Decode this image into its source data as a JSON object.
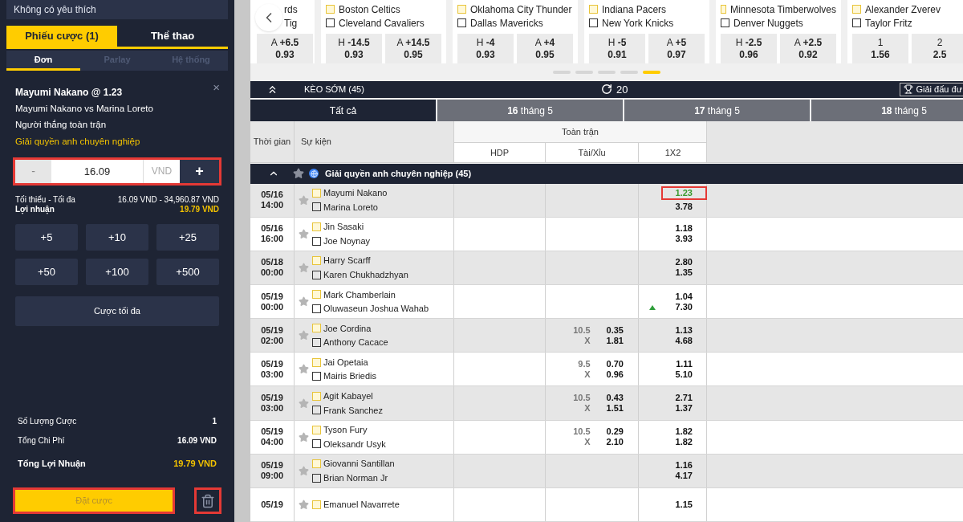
{
  "sidebar": {
    "favorites_label": "Không có yêu thích",
    "tabs": [
      {
        "label": "Phiếu cược (1)",
        "selected": true
      },
      {
        "label": "Thể thao",
        "selected": false
      }
    ],
    "sub_tabs": [
      {
        "label": "Đơn",
        "selected": true,
        "disabled": false
      },
      {
        "label": "Parlay",
        "selected": false,
        "disabled": true
      },
      {
        "label": "Hệ thống",
        "selected": false,
        "disabled": true
      }
    ],
    "bet": {
      "title": "Mayumi Nakano @ 1.23",
      "close": "×",
      "match": "Mayumi Nakano vs Marina Loreto",
      "market": "Người thắng toàn trận",
      "league": "Giải quyền anh chuyên nghiệp",
      "stake": {
        "minus": "-",
        "value": "16.09",
        "currency": "VND",
        "plus": "+",
        "highlighted": true
      },
      "limits_label": "Tối thiểu - Tối đa",
      "limits": "16.09 VND - 34,960.87 VND",
      "profit_label": "Lợi nhuận",
      "profit": "19.79 VND"
    },
    "quick_amounts": [
      "+5",
      "+10",
      "+25",
      "+50",
      "+100",
      "+500"
    ],
    "max_bet": "Cược tối đa",
    "summary": [
      {
        "label": "Số Lượng Cược",
        "value": "1",
        "kind": "plain"
      },
      {
        "label": "Tổng Chi Phí",
        "value": "16.09 VND",
        "kind": "plain"
      },
      {
        "label": "Tổng Lợi Nhuận",
        "value": "19.79 VND",
        "kind": "total"
      }
    ],
    "place_bet": {
      "label": "Đặt cược",
      "disabled": true,
      "highlighted": true
    },
    "delete": {
      "highlighted": true
    }
  },
  "carousel": {
    "cards": [
      {
        "kind": "partial",
        "teams": [
          "rds",
          "Tig"
        ],
        "odds": [
          {
            "side": "A",
            "line": "+6.5",
            "value": "0.93"
          }
        ]
      },
      {
        "kind": "full",
        "teams": [
          "Boston Celtics",
          "Cleveland Cavaliers"
        ],
        "odds": [
          {
            "side": "H",
            "line": "-14.5",
            "value": "0.93"
          },
          {
            "side": "A",
            "line": "+14.5",
            "value": "0.95"
          }
        ]
      },
      {
        "kind": "full",
        "teams": [
          "Oklahoma City Thunder",
          "Dallas Mavericks"
        ],
        "odds": [
          {
            "side": "H",
            "line": "-4",
            "value": "0.93"
          },
          {
            "side": "A",
            "line": "+4",
            "value": "0.95"
          }
        ]
      },
      {
        "kind": "full",
        "teams": [
          "Indiana Pacers",
          "New York Knicks"
        ],
        "odds": [
          {
            "side": "H",
            "line": "-5",
            "value": "0.91"
          },
          {
            "side": "A",
            "line": "+5",
            "value": "0.97"
          }
        ]
      },
      {
        "kind": "full",
        "teams": [
          "Minnesota Timberwolves",
          "Denver Nuggets"
        ],
        "odds": [
          {
            "side": "H",
            "line": "-2.5",
            "value": "0.96"
          },
          {
            "side": "A",
            "line": "+2.5",
            "value": "0.92"
          }
        ]
      },
      {
        "kind": "full",
        "teams": [
          "Alexander Zverev",
          "Taylor Fritz"
        ],
        "odds": [
          {
            "side": "1",
            "value": "1.56"
          },
          {
            "side": "2",
            "value": "2.5"
          }
        ]
      }
    ],
    "pages": [
      {
        "selected": false
      },
      {
        "selected": false
      },
      {
        "selected": false
      },
      {
        "selected": false
      },
      {
        "selected": true
      }
    ]
  },
  "early_bar": {
    "title": "KÈO SỚM (45)",
    "refresh_count": "20",
    "tournaments_button": "Giải đấu đư"
  },
  "date_tabs": [
    {
      "label": "Tất cả",
      "selected": true
    },
    {
      "label": "**16** tháng 5",
      "selected": false
    },
    {
      "label": "**17** tháng 5",
      "selected": false
    },
    {
      "label": "**18** tháng 5",
      "selected": false
    }
  ],
  "table": {
    "columns": {
      "time": "Thời gian",
      "event": "Sự kiện",
      "group": "Toàn trận",
      "hdp": "HDP",
      "ou": "Tài/Xỉu",
      "x12": "1X2"
    },
    "league": "Giải quyền anh chuyên nghiệp (45)",
    "rows": [
      {
        "date": "05/16",
        "time": "14:00",
        "home": "Mayumi Nakano",
        "away": "Marina Loreto",
        "rising": false,
        "x12": [
          {
            "value": "1.23",
            "selected": true
          },
          {
            "value": "3.78",
            "selected": false
          }
        ]
      },
      {
        "date": "05/16",
        "time": "16:00",
        "home": "Jin Sasaki",
        "away": "Joe Noynay",
        "rising": false,
        "x12": [
          {
            "value": "1.18",
            "selected": false
          },
          {
            "value": "3.93",
            "selected": false
          }
        ]
      },
      {
        "date": "05/18",
        "time": "00:00",
        "home": "Harry Scarff",
        "away": "Karen Chukhadzhyan",
        "rising": false,
        "x12": [
          {
            "value": "2.80",
            "selected": false
          },
          {
            "value": "1.35",
            "selected": false
          }
        ]
      },
      {
        "date": "05/19",
        "time": "00:00",
        "home": "Mark Chamberlain",
        "away": "Oluwaseun Joshua Wahab",
        "rising": true,
        "x12": [
          {
            "value": "1.04",
            "selected": false
          },
          {
            "value": "7.30",
            "selected": false
          }
        ]
      },
      {
        "date": "05/19",
        "time": "02:00",
        "home": "Joe Cordina",
        "away": "Anthony Cacace",
        "rising": false,
        "ou": {
          "line": "10.5",
          "under_mark": "X",
          "over": "0.35",
          "under": "1.81"
        },
        "x12": [
          {
            "value": "1.13",
            "selected": false
          },
          {
            "value": "4.68",
            "selected": false
          }
        ]
      },
      {
        "date": "05/19",
        "time": "03:00",
        "home": "Jai Opetaia",
        "away": "Mairis Briedis",
        "rising": false,
        "ou": {
          "line": "9.5",
          "under_mark": "X",
          "over": "0.70",
          "under": "0.96"
        },
        "x12": [
          {
            "value": "1.11",
            "selected": false
          },
          {
            "value": "5.10",
            "selected": false
          }
        ]
      },
      {
        "date": "05/19",
        "time": "03:00",
        "home": "Agit Kabayel",
        "away": "Frank Sanchez",
        "rising": false,
        "ou": {
          "line": "10.5",
          "under_mark": "X",
          "over": "0.43",
          "under": "1.51"
        },
        "x12": [
          {
            "value": "2.71",
            "selected": false
          },
          {
            "value": "1.37",
            "selected": false
          }
        ]
      },
      {
        "date": "05/19",
        "time": "04:00",
        "home": "Tyson Fury",
        "away": "Oleksandr Usyk",
        "rising": false,
        "ou": {
          "line": "10.5",
          "under_mark": "X",
          "over": "0.29",
          "under": "2.10"
        },
        "x12": [
          {
            "value": "1.82",
            "selected": false
          },
          {
            "value": "1.82",
            "selected": false
          }
        ]
      },
      {
        "date": "05/19",
        "time": "09:00",
        "home": "Giovanni Santillan",
        "away": "Brian Norman Jr",
        "rising": false,
        "x12": [
          {
            "value": "1.16",
            "selected": false
          },
          {
            "value": "4.17",
            "selected": false
          }
        ]
      },
      {
        "date": "05/19",
        "home": "Emanuel Navarrete",
        "rising": false,
        "x12": [
          {
            "value": "1.15",
            "selected": false
          }
        ]
      }
    ]
  }
}
